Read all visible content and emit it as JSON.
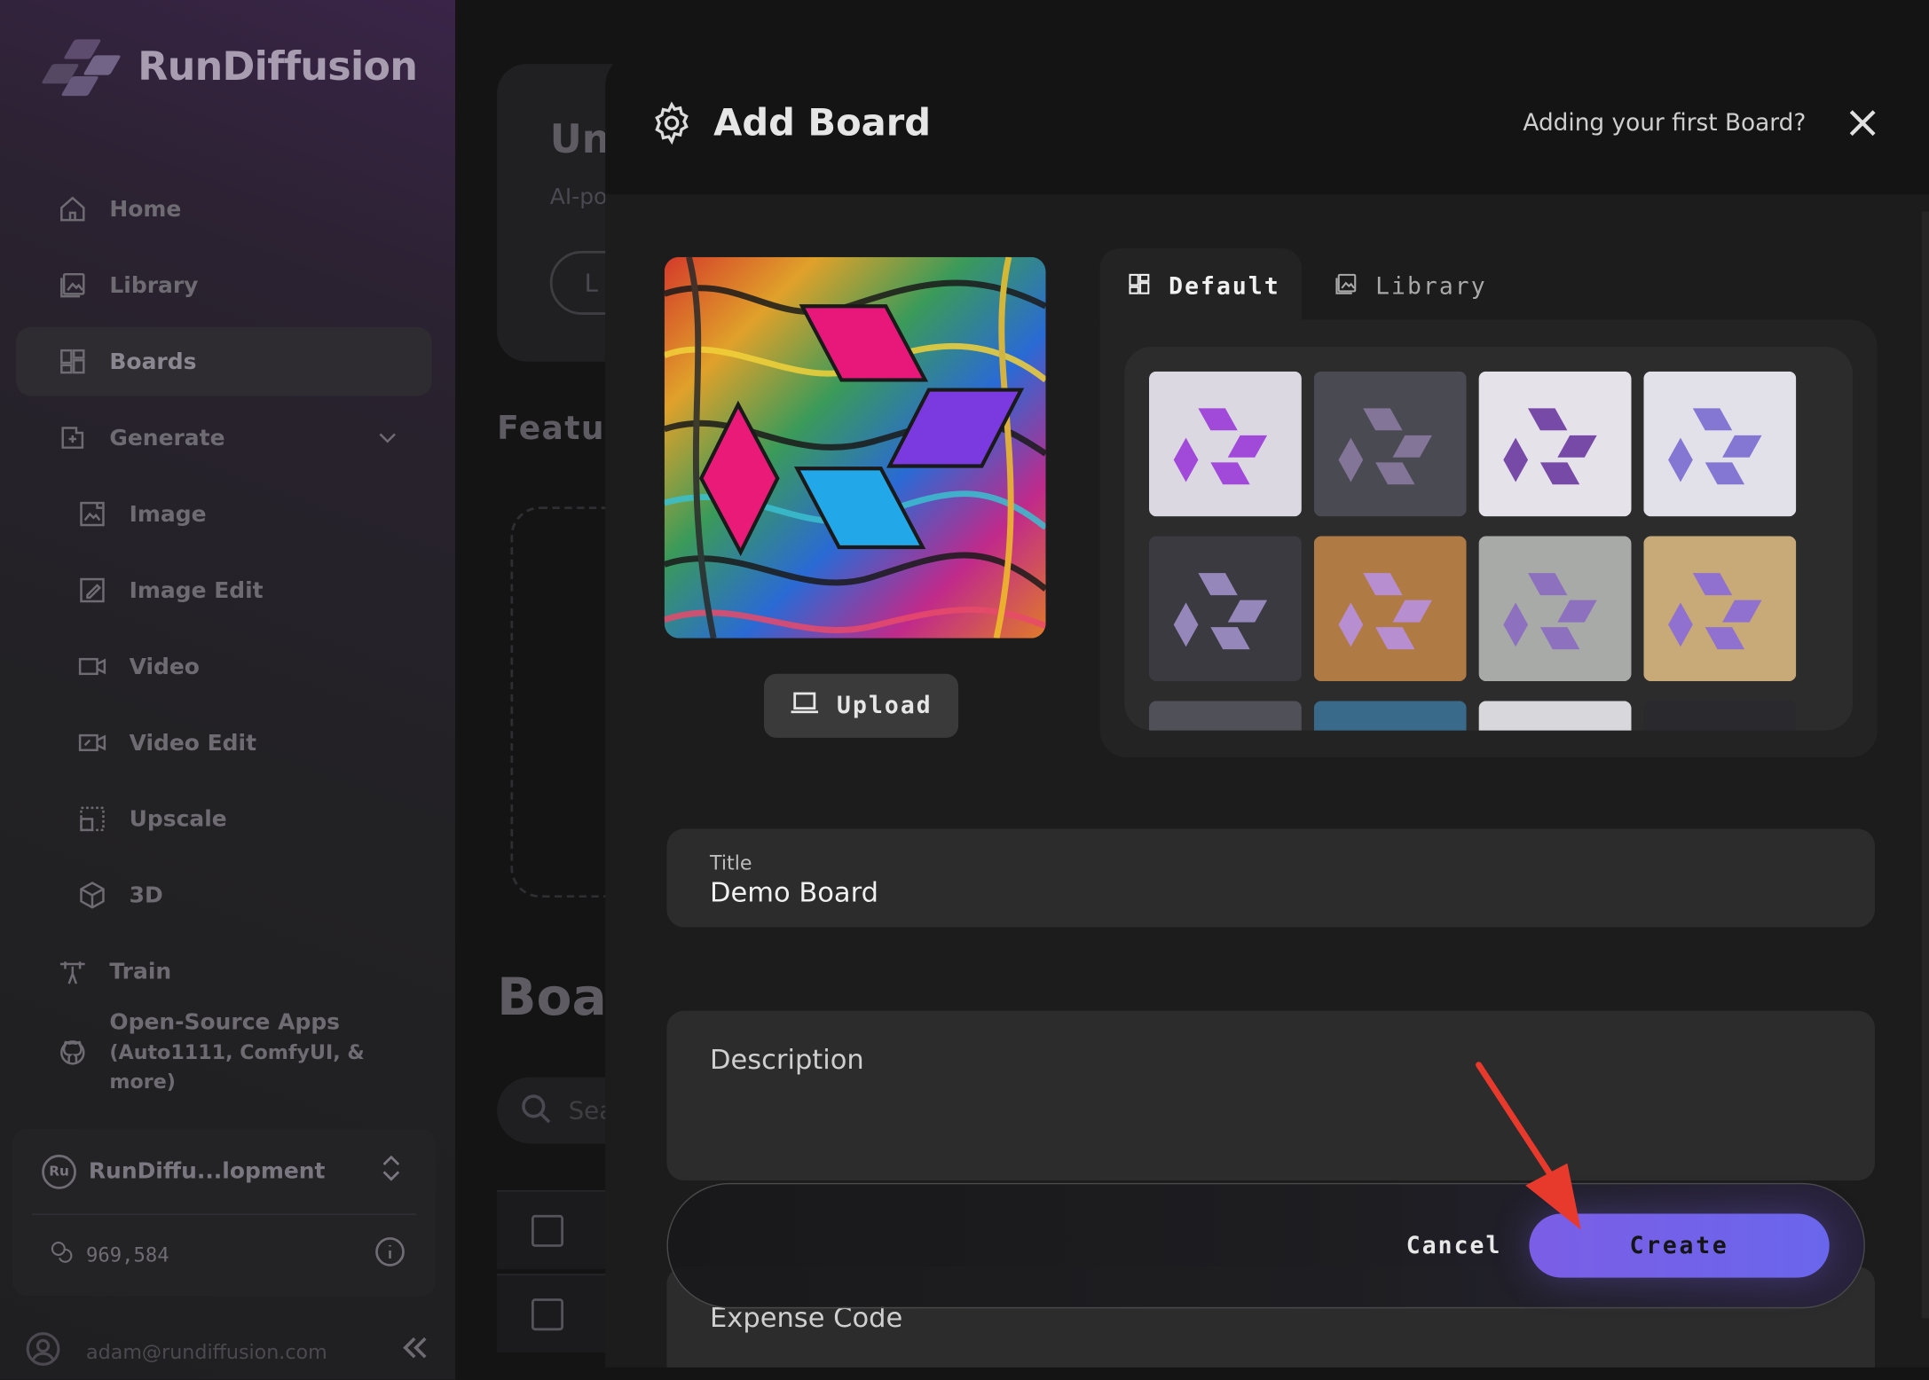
{
  "app": {
    "name": "RunDiffusion"
  },
  "sidebar": {
    "items": [
      {
        "label": "Home",
        "icon": "home-icon"
      },
      {
        "label": "Library",
        "icon": "library-icon"
      },
      {
        "label": "Boards",
        "icon": "boards-icon",
        "active": true
      },
      {
        "label": "Generate",
        "icon": "generate-icon",
        "expandable": true
      },
      {
        "label": "Image",
        "icon": "image-icon",
        "sub": true
      },
      {
        "label": "Image Edit",
        "icon": "image-edit-icon",
        "sub": true
      },
      {
        "label": "Video",
        "icon": "video-icon",
        "sub": true
      },
      {
        "label": "Video Edit",
        "icon": "video-edit-icon",
        "sub": true
      },
      {
        "label": "Upscale",
        "icon": "upscale-icon",
        "sub": true
      },
      {
        "label": "3D",
        "icon": "cube-icon",
        "sub": true
      },
      {
        "label": "Train",
        "icon": "train-icon"
      },
      {
        "label": "Open-Source Apps",
        "label2": "(Auto1111, ComfyUI, & more)",
        "icon": "github-icon"
      }
    ],
    "account": {
      "badge": "Ru",
      "name": "RunDiffu...lopment",
      "credits": "969,584"
    },
    "user": {
      "email": "adam@rundiffusion.com"
    }
  },
  "background": {
    "card_title": "Un",
    "card_sub": "AI-po",
    "pill": "L",
    "featured": "Featur",
    "boards": "Boa",
    "search_placeholder": "Sea"
  },
  "modal": {
    "title": "Add Board",
    "help_link": "Adding your first Board?",
    "upload_label": "Upload",
    "tabs": [
      {
        "label": "Default",
        "active": true
      },
      {
        "label": "Library",
        "active": false
      }
    ],
    "fields": {
      "title_label": "Title",
      "title_value": "Demo Board",
      "description_placeholder": "Description",
      "expense_placeholder": "Expense Code"
    },
    "cancel_label": "Cancel",
    "create_label": "Create"
  },
  "colors": {
    "accent": "#7b5ee6",
    "annotation_arrow": "#e83a2c"
  }
}
